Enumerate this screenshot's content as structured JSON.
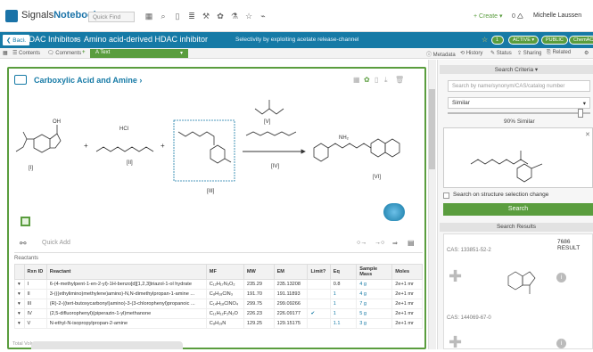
{
  "topbar": {
    "logo_brand": "Signals",
    "logo_product": "Notebook",
    "quick_find_placeholder": "Quick Find",
    "create_label": "+ Create ▾",
    "notifications": "0 🛆",
    "user_name": "Michelle Laussen"
  },
  "titlebar": {
    "back_label": "❮ Back",
    "crumb1": "HDAC Inhibitors",
    "crumb_sep": "›",
    "crumb2": "Amino acid-derived HDAC inhibitor",
    "subtitle": "Selectivity by exploiting acetate release-channel",
    "pill_active": "ACTIVE ▾",
    "pill_public": "PUBLIC",
    "pill_chemacx": "ChemACX"
  },
  "toolbar2": {
    "contents": "Contents",
    "comments": "Comments",
    "add": "+",
    "text_mode": "A  Text",
    "metadata": "Metadata",
    "history": "History",
    "status": "Status",
    "sharing": "Sharing",
    "related": "Related"
  },
  "section": {
    "title": "Carboxylic Acid and Amine  ›"
  },
  "chem_labels": {
    "i": "[I]",
    "ii": "[II]",
    "iii": "[III]",
    "iv": "[IV]",
    "v": "[V]",
    "vi": "[VI]",
    "hcl": "HCl",
    "oh": "OH",
    "nh2": "NH₂"
  },
  "quickadd": {
    "placeholder": "Quick Add"
  },
  "reactants_label": "Reactants",
  "table": {
    "headers": [
      "",
      "Rxn ID",
      "Reactant",
      "MF",
      "MW",
      "EM",
      "Limit?",
      "Eq",
      "Sample Mass",
      "Moles"
    ],
    "rows": [
      [
        "▾",
        "I",
        "6-(4-methylpent-1-en-2-yl)-1H-benzo[d][1,2,3]triazol-1-ol hydrate",
        "C₁₂H₁₇N₃O₂",
        "235.29",
        "235.13208",
        "",
        "0.8",
        "4 g",
        "2e+1 mr"
      ],
      [
        "▾",
        "II",
        "3-(((ethylimino)methylene)amino)-N,N-dimethylpropan-1-amine ...",
        "C₈H₁₈ClN₃",
        "191.70",
        "191.11893",
        "",
        "1",
        "4 g",
        "2e+1 mr"
      ],
      [
        "▾",
        "III",
        "(R)-2-((tert-butoxycarbonyl)amino)-3-(3-chlorophenyl)propanoic ...",
        "C₁₄H₁₈ClNO₄",
        "299.75",
        "299.09266",
        "",
        "1",
        "7 g",
        "2e+1 mr"
      ],
      [
        "▾",
        "IV",
        "(2,5-difluorophenyl)(piperazin-1-yl)methanone",
        "C₁₁H₁₂F₂N₂O",
        "226.23",
        "226.09177",
        "✔",
        "1",
        "5 g",
        "2e+1 mr"
      ],
      [
        "▾",
        "V",
        "N-ethyl-N-isopropylpropan-2-amine",
        "C₈H₁₉N",
        "129.25",
        "129.15175",
        "",
        "1.1",
        "3 g",
        "2e+1 mr"
      ]
    ]
  },
  "footer": {
    "total": "Total Volume: 1.2 mL   Reaction Molarity: 20 molar"
  },
  "rpanel": {
    "criteria_head": "Search Criteria ▾",
    "search_placeholder": "Search by name/synonym/CAS/catalog number",
    "similar": "Similar",
    "similar_pct": "90% Similar",
    "check_label": "Search on structure selection change",
    "search_btn": "Search",
    "results_head": "Search Results",
    "count": "7686 RESULT",
    "cas1": "CAS: 133851-52-2",
    "cas2": "CAS: 144069-67-0"
  },
  "colors": {
    "brand": "#167aa6",
    "accent": "#5a9d3e"
  }
}
